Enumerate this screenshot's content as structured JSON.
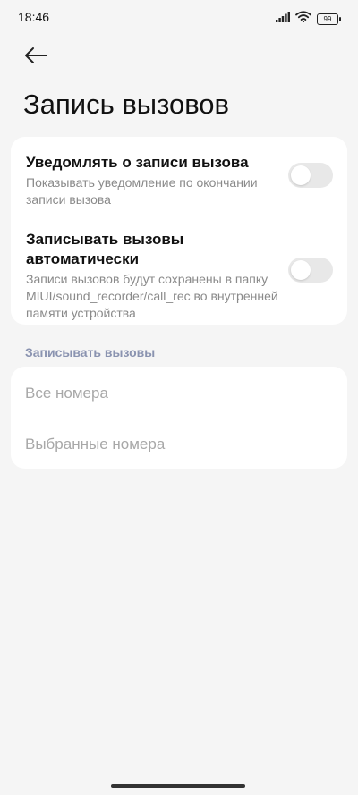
{
  "status_bar": {
    "time": "18:46",
    "battery": "99",
    "icons": [
      "signal-icon",
      "wifi-icon",
      "battery-icon"
    ]
  },
  "header": {
    "back_icon": "arrow-left-icon",
    "title": "Запись вызовов"
  },
  "settings": {
    "notify": {
      "title": "Уведомлять о записи вызова",
      "description": "Показывать уведомление по окончании записи вызова",
      "enabled": false
    },
    "auto_record": {
      "title": "Записывать вызовы автоматически",
      "description": "Записи вызовов будут сохранены в папку MIUI/sound_recorder/call_rec во внутренней памяти устройства",
      "enabled": false
    }
  },
  "record_section": {
    "header": "Записывать вызовы",
    "options": [
      {
        "label": "Все номера"
      },
      {
        "label": "Выбранные номера"
      }
    ]
  },
  "colors": {
    "background": "#f5f5f5",
    "card": "#ffffff",
    "toggle_off": "#e8e8e8",
    "section_header": "#8a93b0",
    "disabled_text": "#a8a8a8"
  }
}
